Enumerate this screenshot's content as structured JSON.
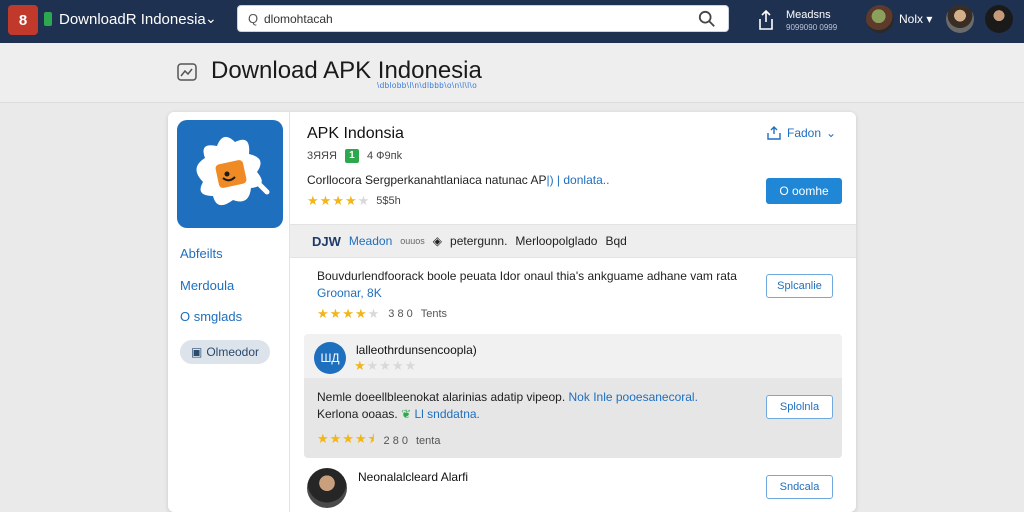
{
  "topbar": {
    "app_icon_label": "8",
    "brand": "DownloadR Indonesia",
    "search": {
      "value": "dlomohtacah",
      "placeholder": ""
    },
    "user": {
      "name": "Meadsns",
      "sub": "9099090 0999"
    },
    "user2": "Nolx ▾",
    "colors": {
      "bar": "#1f3150",
      "accent": "#c0392b",
      "green": "#2ea84f"
    }
  },
  "header": {
    "title": "Download APK Indonesia",
    "subtitle": "\\dblobb\\l\\n\\dlbbb\\o\\n\\l\\l\\o"
  },
  "sidebar": {
    "links": [
      "Abfeilts",
      "Merdoula",
      "O smglads"
    ],
    "button": "Olmeodor"
  },
  "app": {
    "title": "APK Indonsia",
    "meta_left": "3ЯЯЯ",
    "meta_badge": "1",
    "meta_right": "4 Ф9пk",
    "description_plain": "Corllocora Sergperkanahtlaniaca natunac AP",
    "description_highlight": "|) | donlata..",
    "rating_stars": 4,
    "rating_text": "5$5h",
    "top_action": "Fadon",
    "primary_button": "O oomhe"
  },
  "filter_bar": {
    "logo": "DJW",
    "blue": "Meadon",
    "small": "ouuos",
    "item1": "petergunn.",
    "item2": "Merloopolglado",
    "item3": "Bqd"
  },
  "reviews": [
    {
      "text_plain": "Bouvdurlendfoorack boole peuata Idor onaul thia's ankguame adhane vam rata",
      "text_highlight": "Groonar, 8K",
      "stars": 4,
      "count": "3 8 0",
      "label": "Tents",
      "button": "Splcanlie"
    },
    {
      "author": "lalleothrdunsencoopla)",
      "avatar_text": "ШД",
      "author_stars": 1,
      "text_plain": "Nemle doeellbleenokat alarinias adatip vipeop.",
      "text_highlight": "Nok Inle pooesanecoral.",
      "text_line2_plain": "Kerlona ooaas.",
      "text_line2_highlight": "Ll snddatna.",
      "stars": 4.5,
      "count": "2 8 0",
      "label": "tenta",
      "button": "Splolnla"
    },
    {
      "author": "Neonalalcleard Alarfi",
      "button": "Sndcala"
    }
  ]
}
